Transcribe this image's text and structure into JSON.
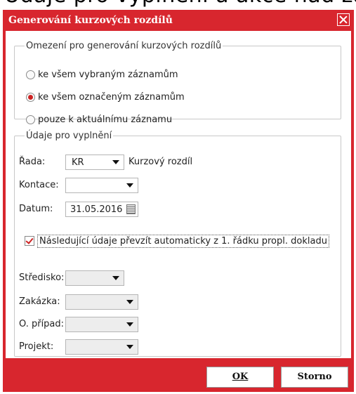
{
  "top_text": "Údaje pro vyplnění a akce nad záznamy pohledu",
  "dialog": {
    "title": "Generování kurzových rozdílů"
  },
  "section1": {
    "legend": "Omezení pro generování kurzových rozdílů",
    "options": [
      {
        "label": "ke všem vybraným záznamům",
        "selected": false
      },
      {
        "label": "ke všem označeným záznamům",
        "selected": true
      },
      {
        "label": "pouze k aktuálnímu záznamu",
        "selected": false
      }
    ]
  },
  "section2": {
    "legend": "Údaje pro vyplnění",
    "rada": {
      "label": "Řada:",
      "value": "KR",
      "description": "Kurzový rozdíl"
    },
    "kontace": {
      "label": "Kontace:",
      "value": ""
    },
    "datum": {
      "label": "Datum:",
      "value": "31.05.2016"
    },
    "checkbox": {
      "label": "Následující údaje převzít automaticky z 1. řádku propl. dokladu",
      "checked": true
    },
    "stredisko": {
      "label": "Středisko:",
      "value": ""
    },
    "zakazka": {
      "label": "Zakázka:",
      "value": ""
    },
    "pripad": {
      "label": "O. případ:",
      "value": ""
    },
    "projekt": {
      "label": "Projekt:",
      "value": ""
    }
  },
  "buttons": {
    "ok": "OK",
    "storno": "Storno"
  },
  "colors": {
    "accent": "#d8262e"
  }
}
